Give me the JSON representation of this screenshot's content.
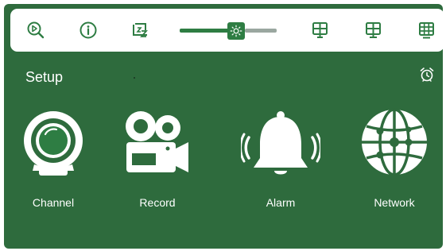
{
  "toolbar": {
    "icons": [
      "playback-search-icon",
      "info-icon",
      "sleep-icon",
      "brightness-icon",
      "single-view-icon",
      "four-split-icon",
      "nine-split-icon"
    ],
    "brightness_level": 0.6
  },
  "setup": {
    "title": "Setup",
    "menu": [
      {
        "label": "Channel",
        "icon": "camera-icon"
      },
      {
        "label": "Record",
        "icon": "video-camera-icon"
      },
      {
        "label": "Alarm",
        "icon": "alarm-bell-icon"
      },
      {
        "label": "Network",
        "icon": "globe-network-icon"
      }
    ]
  },
  "colors": {
    "background": "#2e6b3d",
    "accent": "#2e7d43",
    "toolbar": "#ffffff",
    "text": "#ffffff"
  }
}
